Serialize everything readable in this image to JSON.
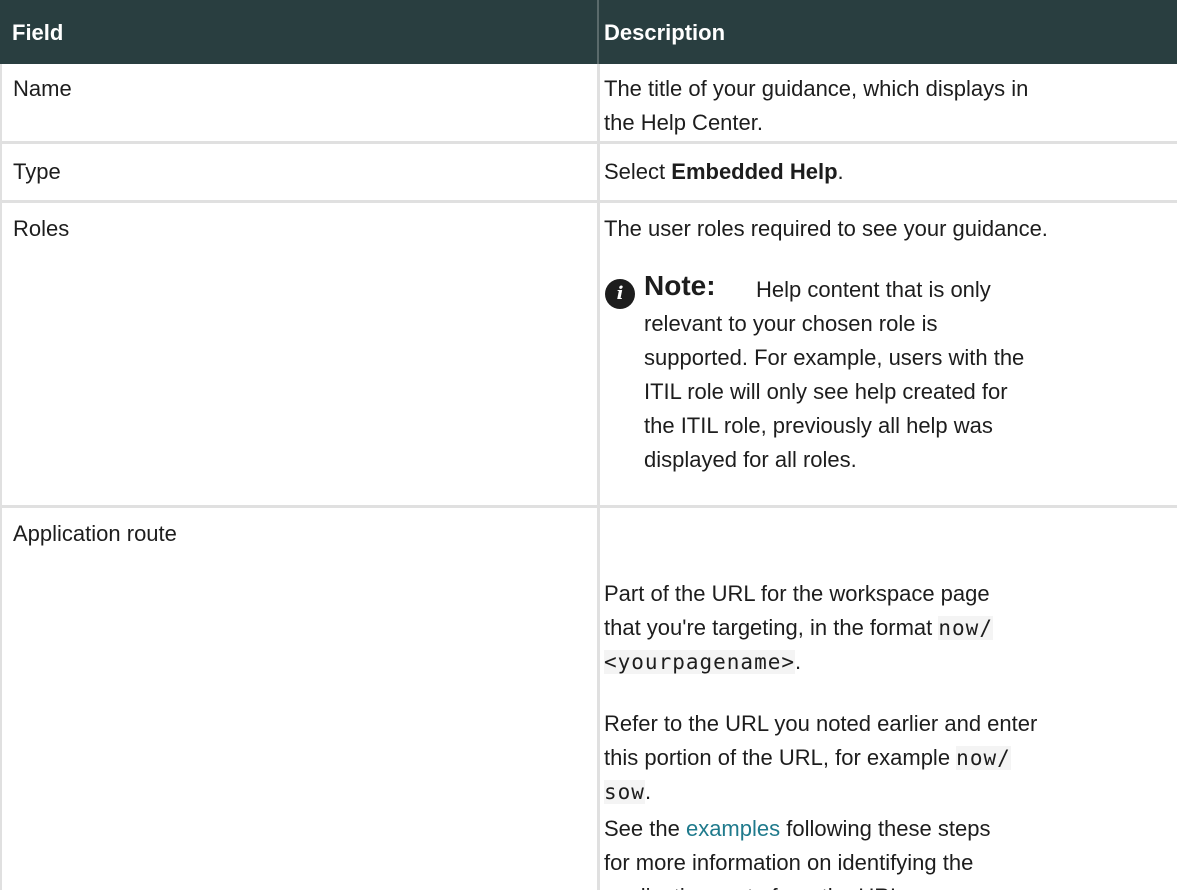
{
  "header": {
    "field": "Field",
    "description": "Description"
  },
  "rows": [
    {
      "field": "Name",
      "desc_line1": "The title of your guidance, which displays in",
      "desc_line2": "the Help Center."
    },
    {
      "field": "Type",
      "desc_prefix": "Select ",
      "desc_bold": "Embedded Help",
      "desc_suffix": "."
    },
    {
      "field": "Roles",
      "desc": "The user roles required to see your guidance.",
      "note_title": "Note:",
      "note_line1": "Help content that is only",
      "note_line2": "relevant to your chosen role is",
      "note_line3": "supported. For example, users with the",
      "note_line4": "ITIL role will only see help created for",
      "note_line5": "the ITIL role, previously all help was",
      "note_line6": "displayed for all roles."
    },
    {
      "field": "Application route",
      "p1_line1": "Part of the URL for the workspace page",
      "p1_line2": "that you're targeting, in the format ",
      "p1_code1": "now/",
      "p1_code2": "<yourpagename>",
      "p1_end": ".",
      "p2_line1": "Refer to the URL you noted earlier and enter",
      "p2_line2": "this portion of the URL, for example ",
      "p2_code1": "now/",
      "p2_code2": "sow",
      "p2_end": ".",
      "p3_prefix": "See the ",
      "p3_link": "examples",
      "p3_line1_suffix": " following these steps",
      "p3_line2": "for more information on identifying the",
      "p3_line3": "application route from the URL."
    }
  ],
  "colors": {
    "header_bg": "#293e40",
    "link": "#1f7a8c"
  },
  "icons": {
    "note": "info-icon"
  }
}
